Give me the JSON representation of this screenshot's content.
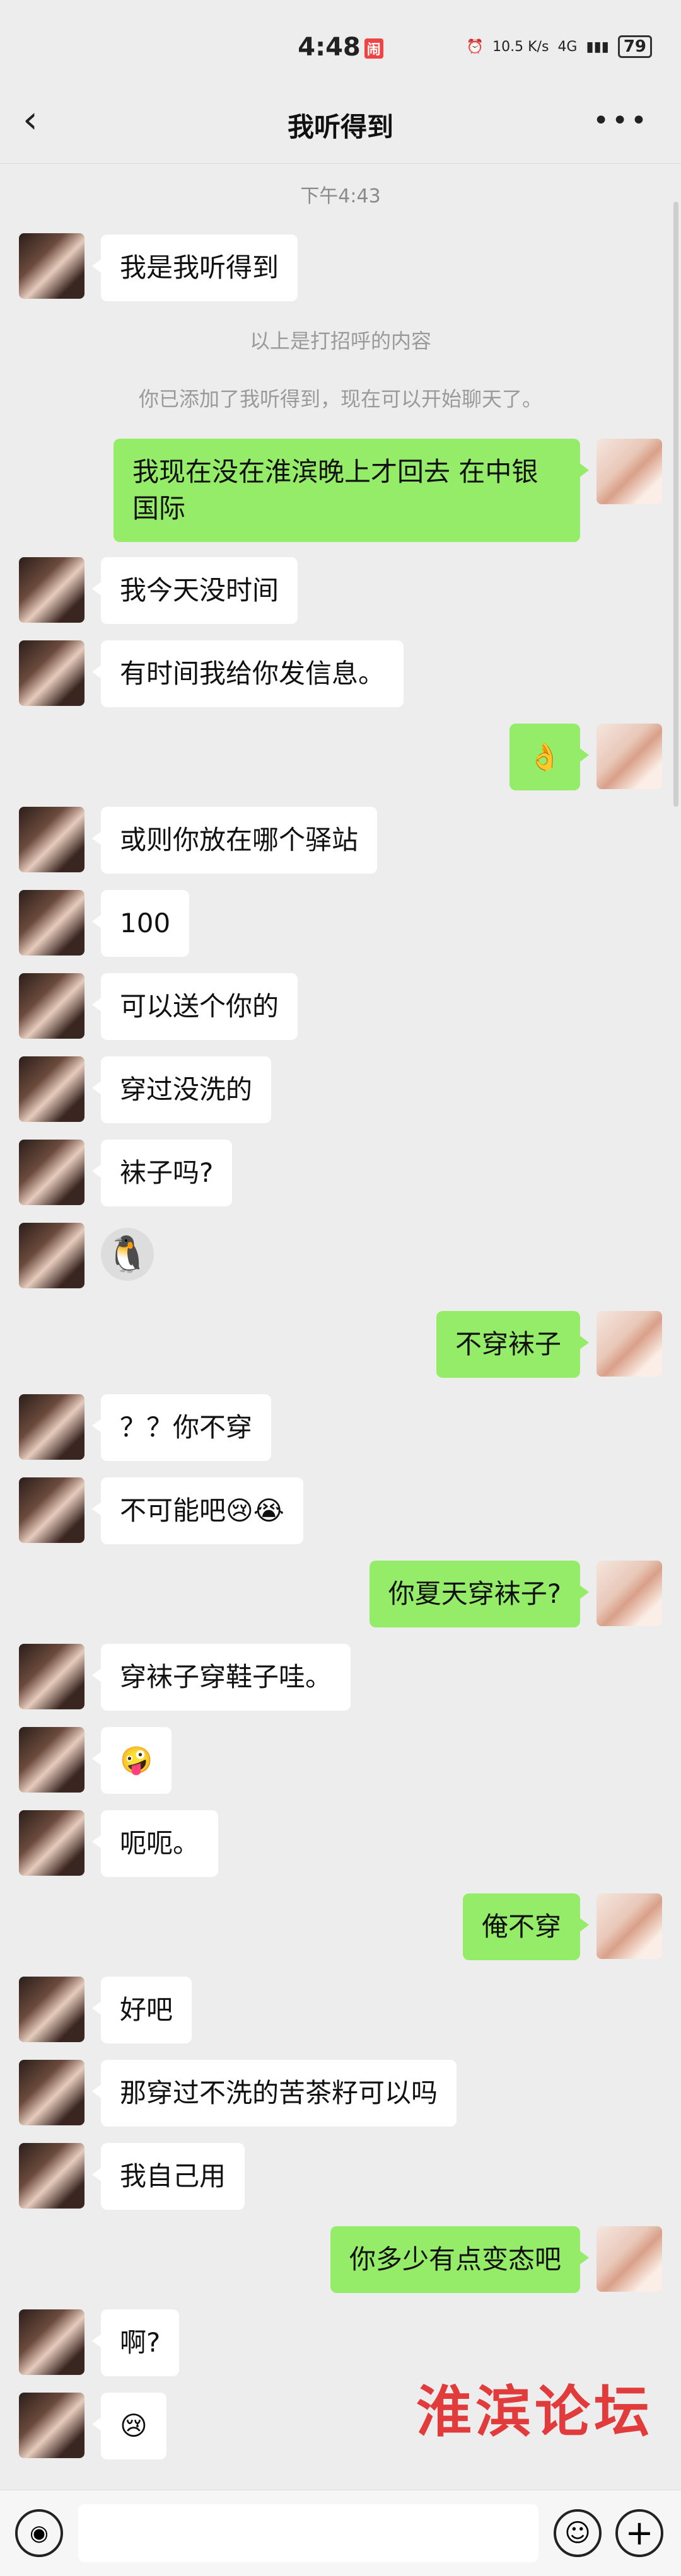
{
  "status": {
    "time": "4:48",
    "badge": "闹",
    "network": "10.5 K/s",
    "signal": "4G",
    "battery": "79"
  },
  "nav": {
    "back_icon": "chevron-left-icon",
    "title": "我听得到",
    "more_icon": "more-icon"
  },
  "chat": {
    "timestamp": "下午4:43",
    "system": [
      "以上是打招呼的内容",
      "你已添加了我听得到，现在可以开始聊天了。"
    ],
    "messages": [
      {
        "side": "left",
        "text": "我是我听得到"
      },
      {
        "side": "right",
        "text": "我现在没在淮滨晚上才回去  在中银国际"
      },
      {
        "side": "left",
        "text": "我今天没时间"
      },
      {
        "side": "left",
        "text": "有时间我给你发信息。"
      },
      {
        "side": "right",
        "text": "👌"
      },
      {
        "side": "left",
        "text": "或则你放在哪个驿站"
      },
      {
        "side": "left",
        "text": "100"
      },
      {
        "side": "left",
        "text": "可以送个你的"
      },
      {
        "side": "left",
        "text": "穿过没洗的"
      },
      {
        "side": "left",
        "text": "袜子吗?"
      },
      {
        "side": "left",
        "text": "🐧"
      },
      {
        "side": "right",
        "text": "不穿袜子"
      },
      {
        "side": "left",
        "text": "？？你不穿"
      },
      {
        "side": "left",
        "text": "不可能吧😢😭"
      },
      {
        "side": "right",
        "text": "你夏天穿袜子?"
      },
      {
        "side": "left",
        "text": "穿袜子穿鞋子哇。"
      },
      {
        "side": "left",
        "text": "🤪"
      },
      {
        "side": "left",
        "text": "呃呃。"
      },
      {
        "side": "right",
        "text": "俺不穿"
      },
      {
        "side": "left",
        "text": "好吧"
      },
      {
        "side": "left",
        "text": "那穿过不洗的苦茶籽可以吗"
      },
      {
        "side": "left",
        "text": "我自己用"
      },
      {
        "side": "right",
        "text": "你多少有点变态吧"
      },
      {
        "side": "left",
        "text": "啊?"
      },
      {
        "side": "left",
        "text": "😢"
      }
    ]
  },
  "watermark": "淮滨论坛",
  "input": {
    "voice_icon": "voice-icon",
    "emoji_icon": "emoji-icon",
    "plus_icon": "plus-icon"
  }
}
